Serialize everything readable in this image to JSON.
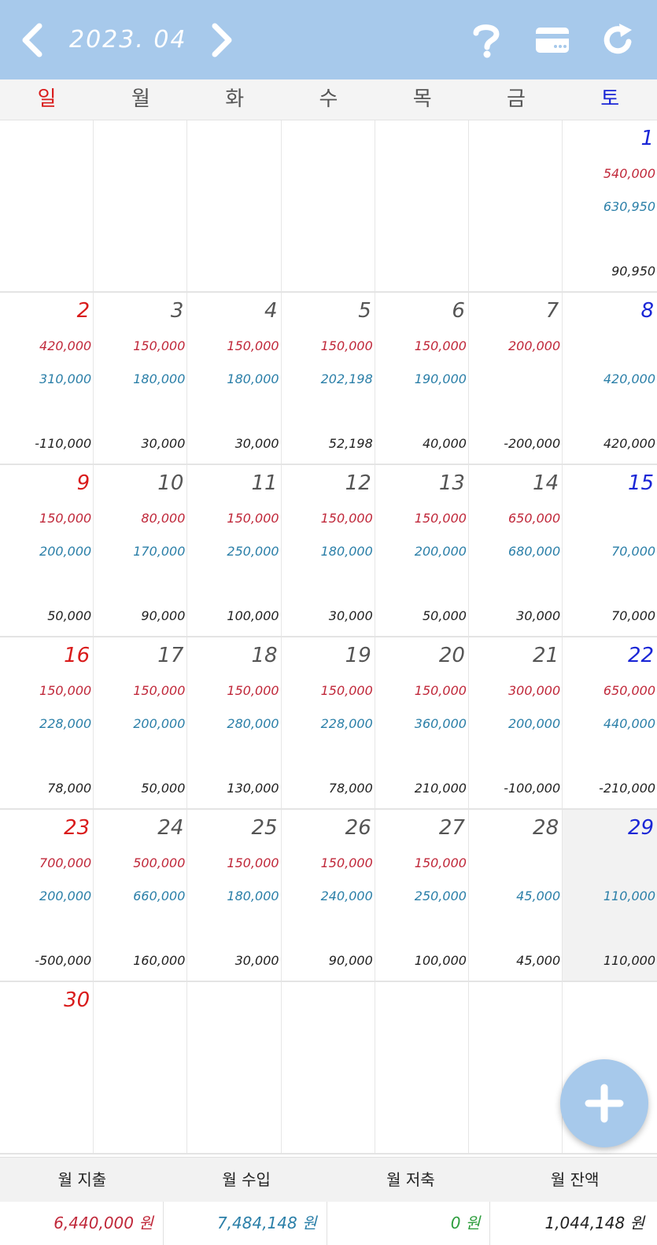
{
  "header": {
    "month": "2023. 04",
    "icons": [
      "chevron-left-icon",
      "chevron-right-icon",
      "help-icon",
      "card-icon",
      "refresh-icon"
    ]
  },
  "weekdays": [
    "일",
    "월",
    "화",
    "수",
    "목",
    "금",
    "토"
  ],
  "weeks": [
    [
      {
        "day": "",
        "exp": "",
        "inc": "",
        "bal": ""
      },
      {
        "day": "",
        "exp": "",
        "inc": "",
        "bal": ""
      },
      {
        "day": "",
        "exp": "",
        "inc": "",
        "bal": ""
      },
      {
        "day": "",
        "exp": "",
        "inc": "",
        "bal": ""
      },
      {
        "day": "",
        "exp": "",
        "inc": "",
        "bal": ""
      },
      {
        "day": "",
        "exp": "",
        "inc": "",
        "bal": ""
      },
      {
        "day": "1",
        "exp": "540,000",
        "inc": "630,950",
        "bal": "90,950"
      }
    ],
    [
      {
        "day": "2",
        "exp": "420,000",
        "inc": "310,000",
        "bal": "-110,000"
      },
      {
        "day": "3",
        "exp": "150,000",
        "inc": "180,000",
        "bal": "30,000"
      },
      {
        "day": "4",
        "exp": "150,000",
        "inc": "180,000",
        "bal": "30,000"
      },
      {
        "day": "5",
        "exp": "150,000",
        "inc": "202,198",
        "bal": "52,198"
      },
      {
        "day": "6",
        "exp": "150,000",
        "inc": "190,000",
        "bal": "40,000"
      },
      {
        "day": "7",
        "exp": "200,000",
        "inc": "",
        "bal": "-200,000"
      },
      {
        "day": "8",
        "exp": "",
        "inc": "420,000",
        "bal": "420,000"
      }
    ],
    [
      {
        "day": "9",
        "exp": "150,000",
        "inc": "200,000",
        "bal": "50,000"
      },
      {
        "day": "10",
        "exp": "80,000",
        "inc": "170,000",
        "bal": "90,000"
      },
      {
        "day": "11",
        "exp": "150,000",
        "inc": "250,000",
        "bal": "100,000"
      },
      {
        "day": "12",
        "exp": "150,000",
        "inc": "180,000",
        "bal": "30,000"
      },
      {
        "day": "13",
        "exp": "150,000",
        "inc": "200,000",
        "bal": "50,000"
      },
      {
        "day": "14",
        "exp": "650,000",
        "inc": "680,000",
        "bal": "30,000"
      },
      {
        "day": "15",
        "exp": "",
        "inc": "70,000",
        "bal": "70,000"
      }
    ],
    [
      {
        "day": "16",
        "exp": "150,000",
        "inc": "228,000",
        "bal": "78,000"
      },
      {
        "day": "17",
        "exp": "150,000",
        "inc": "200,000",
        "bal": "50,000"
      },
      {
        "day": "18",
        "exp": "150,000",
        "inc": "280,000",
        "bal": "130,000"
      },
      {
        "day": "19",
        "exp": "150,000",
        "inc": "228,000",
        "bal": "78,000"
      },
      {
        "day": "20",
        "exp": "150,000",
        "inc": "360,000",
        "bal": "210,000"
      },
      {
        "day": "21",
        "exp": "300,000",
        "inc": "200,000",
        "bal": "-100,000"
      },
      {
        "day": "22",
        "exp": "650,000",
        "inc": "440,000",
        "bal": "-210,000"
      }
    ],
    [
      {
        "day": "23",
        "exp": "700,000",
        "inc": "200,000",
        "bal": "-500,000"
      },
      {
        "day": "24",
        "exp": "500,000",
        "inc": "660,000",
        "bal": "160,000"
      },
      {
        "day": "25",
        "exp": "150,000",
        "inc": "180,000",
        "bal": "30,000"
      },
      {
        "day": "26",
        "exp": "150,000",
        "inc": "240,000",
        "bal": "90,000"
      },
      {
        "day": "27",
        "exp": "150,000",
        "inc": "250,000",
        "bal": "100,000"
      },
      {
        "day": "28",
        "exp": "",
        "inc": "45,000",
        "bal": "45,000"
      },
      {
        "day": "29",
        "exp": "",
        "inc": "110,000",
        "bal": "110,000"
      }
    ],
    [
      {
        "day": "30",
        "exp": "",
        "inc": "",
        "bal": ""
      },
      {
        "day": "",
        "exp": "",
        "inc": "",
        "bal": ""
      },
      {
        "day": "",
        "exp": "",
        "inc": "",
        "bal": ""
      },
      {
        "day": "",
        "exp": "",
        "inc": "",
        "bal": ""
      },
      {
        "day": "",
        "exp": "",
        "inc": "",
        "bal": ""
      },
      {
        "day": "",
        "exp": "",
        "inc": "",
        "bal": ""
      },
      {
        "day": "",
        "exp": "",
        "inc": "",
        "bal": ""
      }
    ]
  ],
  "summary": {
    "labels": [
      "월 지출",
      "월 수입",
      "월 저축",
      "월 잔액"
    ],
    "values": [
      "6,440,000 원",
      "7,484,148 원",
      "0 원",
      "1,044,148 원"
    ],
    "colors": [
      "#c0283a",
      "#2b7fa8",
      "#2e9e3e",
      "#222222"
    ]
  },
  "colors": {
    "header_bg": "#a7c9eb",
    "sunday": "#d91b1b",
    "saturday": "#1a26d6",
    "expense": "#c0283a",
    "income": "#2b7fa8"
  },
  "fab_icon": "plus-icon"
}
